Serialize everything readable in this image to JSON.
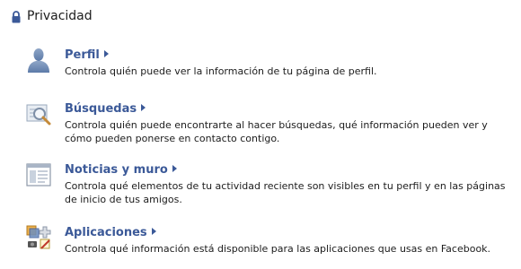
{
  "header": {
    "title": "Privacidad",
    "icon": "lock-icon"
  },
  "sections": [
    {
      "icon": "profile-silhouette-icon",
      "title": "Perfil",
      "description": "Controla quién puede ver la información de tu página de perfil."
    },
    {
      "icon": "magnifier-search-icon",
      "title": "Búsquedas",
      "description": "Controla quién puede encontrarte al hacer búsquedas, qué información pueden ver y cómo pueden ponerse en contacto contigo."
    },
    {
      "icon": "news-feed-icon",
      "title": "Noticias y muro",
      "description": "Controla qué elementos de tu actividad reciente son visibles en tu perfil y en las páginas de inicio de tus amigos."
    },
    {
      "icon": "applications-icon",
      "title": "Aplicaciones",
      "description": "Controla qué información está disponible para las aplicaciones que usas en Facebook."
    }
  ],
  "colors": {
    "link": "#3b5998",
    "text": "#1c1c1c"
  }
}
